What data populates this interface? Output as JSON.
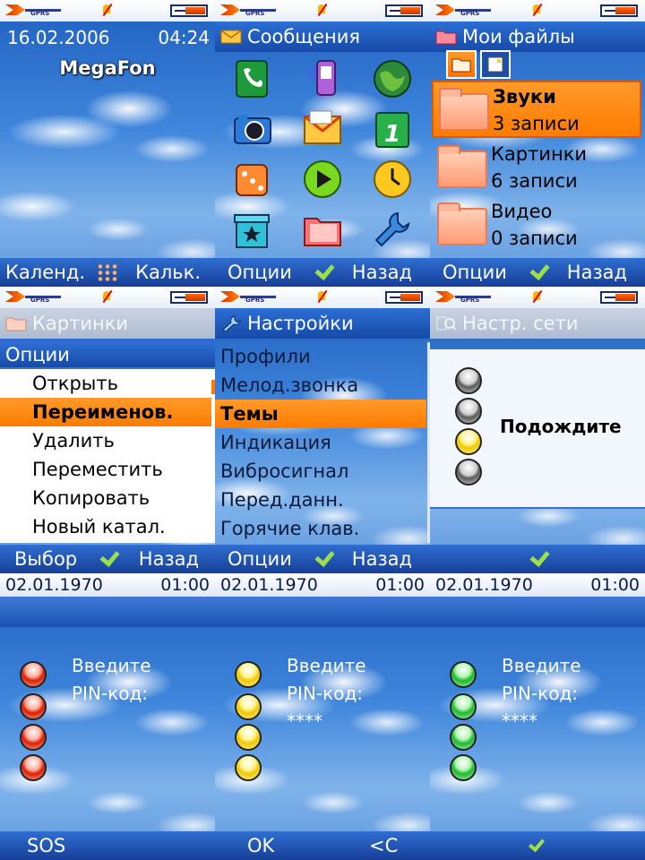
{
  "status": {
    "network": "GPRS"
  },
  "home": {
    "date": "16.02.2006",
    "time": "04:24",
    "operator": "MegaFon",
    "left_soft": "Календ.",
    "right_soft": "Кальк."
  },
  "messages": {
    "title": "Сообщения",
    "left_soft": "Опции",
    "right_soft": "Назад",
    "icons": [
      "phone-icon",
      "phonebook-icon",
      "globe-icon",
      "camera-icon",
      "envelope-icon",
      "calendar-icon",
      "dice-icon",
      "media-player-icon",
      "clock-icon",
      "star-box-icon",
      "folder-icon",
      "wrench-icon"
    ]
  },
  "myfiles": {
    "title": "Мои файлы",
    "left_soft": "Опции",
    "right_soft": "Назад",
    "folders": [
      {
        "name": "Звуки",
        "count": "3 записи"
      },
      {
        "name": "Картинки",
        "count": "6 записи"
      },
      {
        "name": "Видео",
        "count": "0 записи"
      }
    ]
  },
  "pictures": {
    "title": "Картинки",
    "header": "Опции",
    "items": [
      "Открыть",
      "Переименов.",
      "Удалить",
      "Переместить",
      "Копировать",
      "Новый катал."
    ],
    "left_soft": "Выбор",
    "right_soft": "Назад"
  },
  "settings": {
    "title": "Настройки",
    "items": [
      "Профили",
      "Мелод.звонка",
      "Темы",
      "Индикация",
      "Вибросигнал",
      "Перед.данн.",
      "Горячие клав."
    ],
    "left_soft": "Опции",
    "right_soft": "Назад"
  },
  "network": {
    "title": "Настр. сети",
    "message": "Подождите"
  },
  "pin1": {
    "date": "02.01.1970",
    "time": "01:00",
    "prompt1": "Введите",
    "prompt2": "PIN-код:",
    "value": "",
    "left_soft": "SOS"
  },
  "pin2": {
    "date": "02.01.1970",
    "time": "01:00",
    "prompt1": "Введите",
    "prompt2": "PIN-код:",
    "value": "****",
    "left_soft": "OK",
    "right_soft": "<C"
  },
  "pin3": {
    "date": "02.01.1970",
    "time": "01:00",
    "prompt1": "Введите",
    "prompt2": "PIN-код:",
    "value": "****"
  }
}
